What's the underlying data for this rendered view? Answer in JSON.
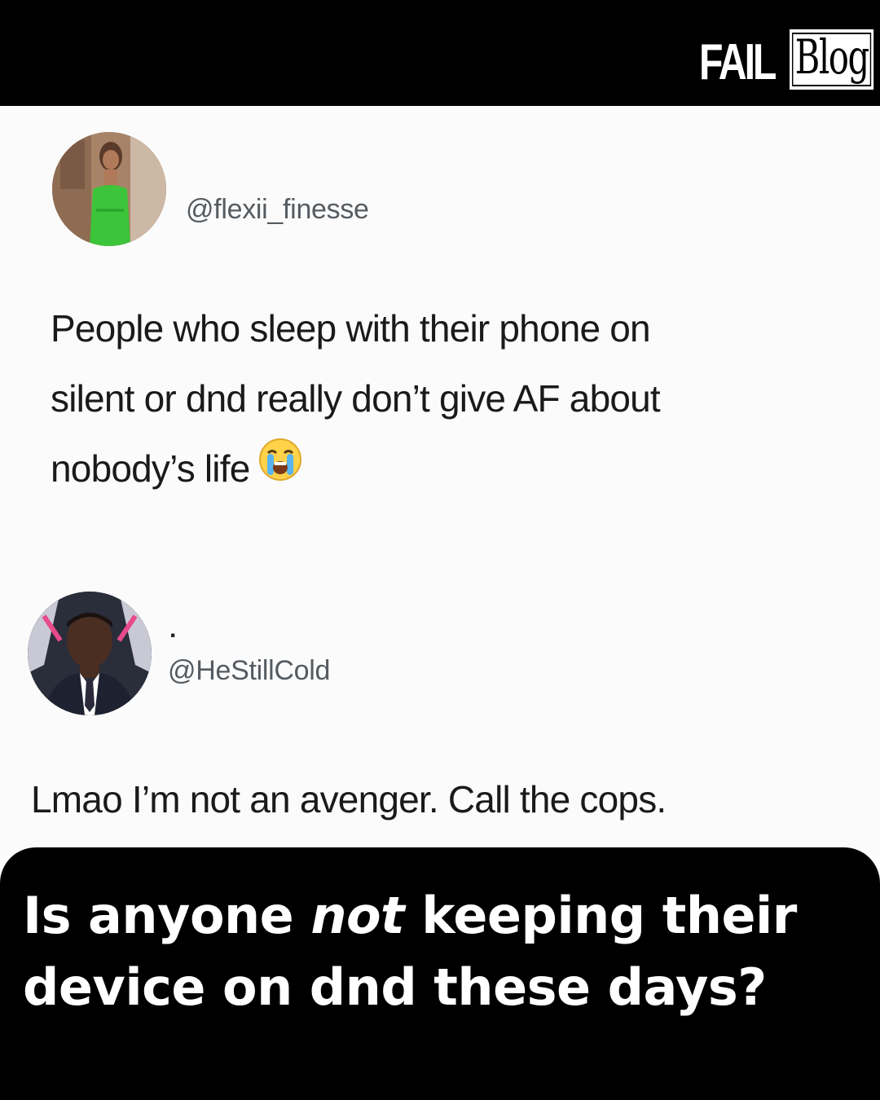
{
  "header": {
    "logo_fail": "FAIL",
    "logo_blog": "Blog"
  },
  "tweet_1": {
    "handle": "@flexii_finesse",
    "text_lines": [
      "People who sleep with their phone on",
      "silent or dnd really don’t give AF about",
      "nobody’s life"
    ],
    "emoji": "loudly-crying-face"
  },
  "tweet_2": {
    "display_name": ".",
    "handle": "@HeStillCold",
    "text": "Lmao I’m not an avenger. Call the cops."
  },
  "caption": {
    "line1_before": "Is anyone ",
    "line1_emphasis": "not",
    "line1_after": " keeping their",
    "line2": "device on dnd these days?"
  },
  "colors": {
    "bar_bg": "#000000",
    "tweet_bg": "#fbfbfb",
    "handle_text": "#555b60",
    "body_text": "#1a1a1a",
    "caption_text": "#ffffff"
  }
}
